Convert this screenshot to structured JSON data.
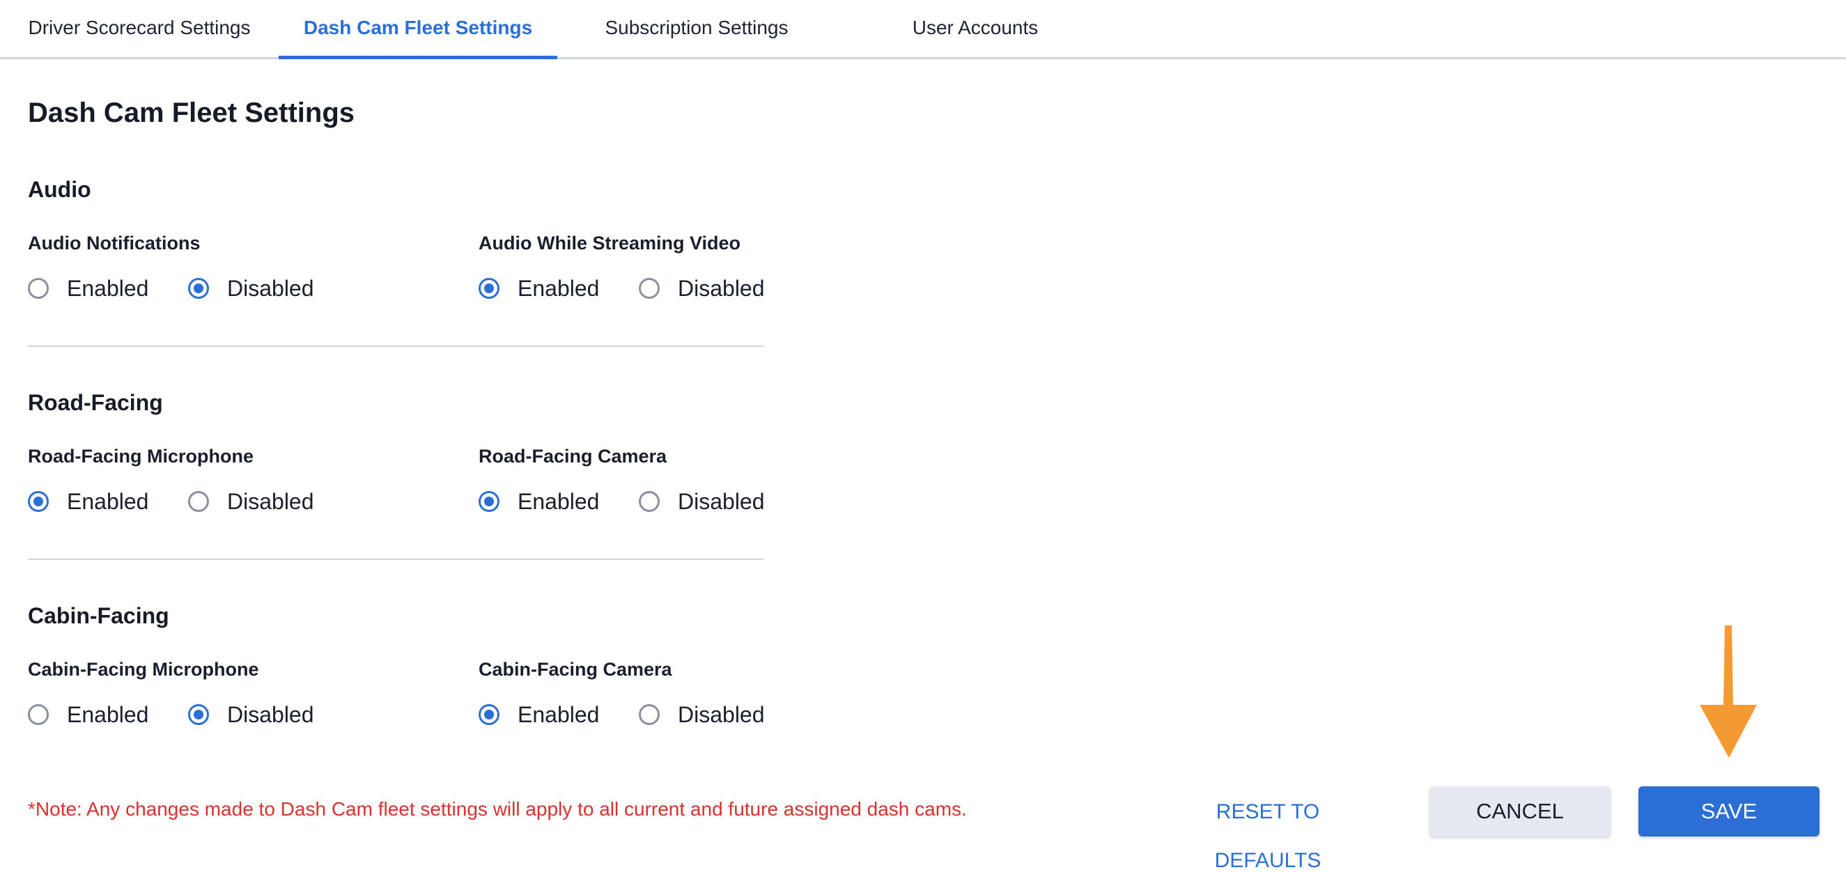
{
  "tabs": [
    {
      "label": "Driver Scorecard Settings",
      "active": false
    },
    {
      "label": "Dash Cam Fleet Settings",
      "active": true
    },
    {
      "label": "Subscription Settings",
      "active": false
    },
    {
      "label": "User Accounts",
      "active": false
    }
  ],
  "page_title": "Dash Cam Fleet Settings",
  "sections": {
    "audio": {
      "title": "Audio",
      "fields": [
        {
          "label": "Audio Notifications",
          "options": [
            "Enabled",
            "Disabled"
          ],
          "selected": "Disabled"
        },
        {
          "label": "Audio While Streaming Video",
          "options": [
            "Enabled",
            "Disabled"
          ],
          "selected": "Enabled"
        }
      ]
    },
    "road_facing": {
      "title": "Road-Facing",
      "fields": [
        {
          "label": "Road-Facing Microphone",
          "options": [
            "Enabled",
            "Disabled"
          ],
          "selected": "Enabled"
        },
        {
          "label": "Road-Facing Camera",
          "options": [
            "Enabled",
            "Disabled"
          ],
          "selected": "Enabled"
        }
      ]
    },
    "cabin_facing": {
      "title": "Cabin-Facing",
      "fields": [
        {
          "label": "Cabin-Facing Microphone",
          "options": [
            "Enabled",
            "Disabled"
          ],
          "selected": "Disabled"
        },
        {
          "label": "Cabin-Facing Camera",
          "options": [
            "Enabled",
            "Disabled"
          ],
          "selected": "Enabled"
        }
      ]
    }
  },
  "footer": {
    "note": "*Note: Any changes made to Dash Cam fleet settings will apply to all current and future assigned dash cams.",
    "reset_label": "RESET TO DEFAULTS",
    "cancel_label": "CANCEL",
    "save_label": "SAVE"
  },
  "colors": {
    "accent": "#2b6fd6",
    "note": "#d8322d",
    "annotation_arrow": "#f39a32"
  },
  "icons": {
    "annotation": "arrow-down-icon"
  }
}
